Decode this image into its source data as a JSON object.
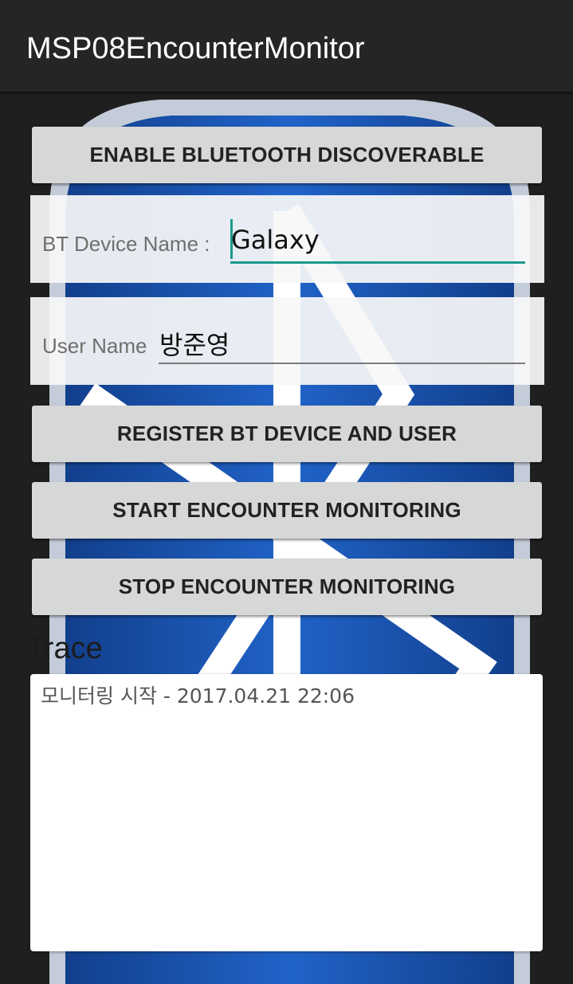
{
  "app_bar": {
    "title": "MSP08EncounterMonitor"
  },
  "buttons": {
    "enable_discoverable": "ENABLE BLUETOOTH DISCOVERABLE",
    "register": "REGISTER BT DEVICE AND USER",
    "start_monitoring": "START ENCOUNTER MONITORING",
    "stop_monitoring": "STOP ENCOUNTER MONITORING"
  },
  "device_field": {
    "label": "BT Device Name :",
    "value": "Galaxy",
    "focused": true
  },
  "user_field": {
    "label": "User Name",
    "value": "방준영"
  },
  "trace": {
    "label": "Trace",
    "lines": [
      "모니터링 시작 - 2017.04.21 22:06"
    ]
  },
  "background": {
    "icon": "bluetooth-logo-icon",
    "colors": {
      "logo_blue": "#1b56b5",
      "logo_border": "#c9d2e3",
      "rune_white": "#ffffff"
    }
  },
  "colors": {
    "accent": "#1a9a8c",
    "button_bg": "#d6d7d7",
    "app_bar_bg": "#252525"
  }
}
